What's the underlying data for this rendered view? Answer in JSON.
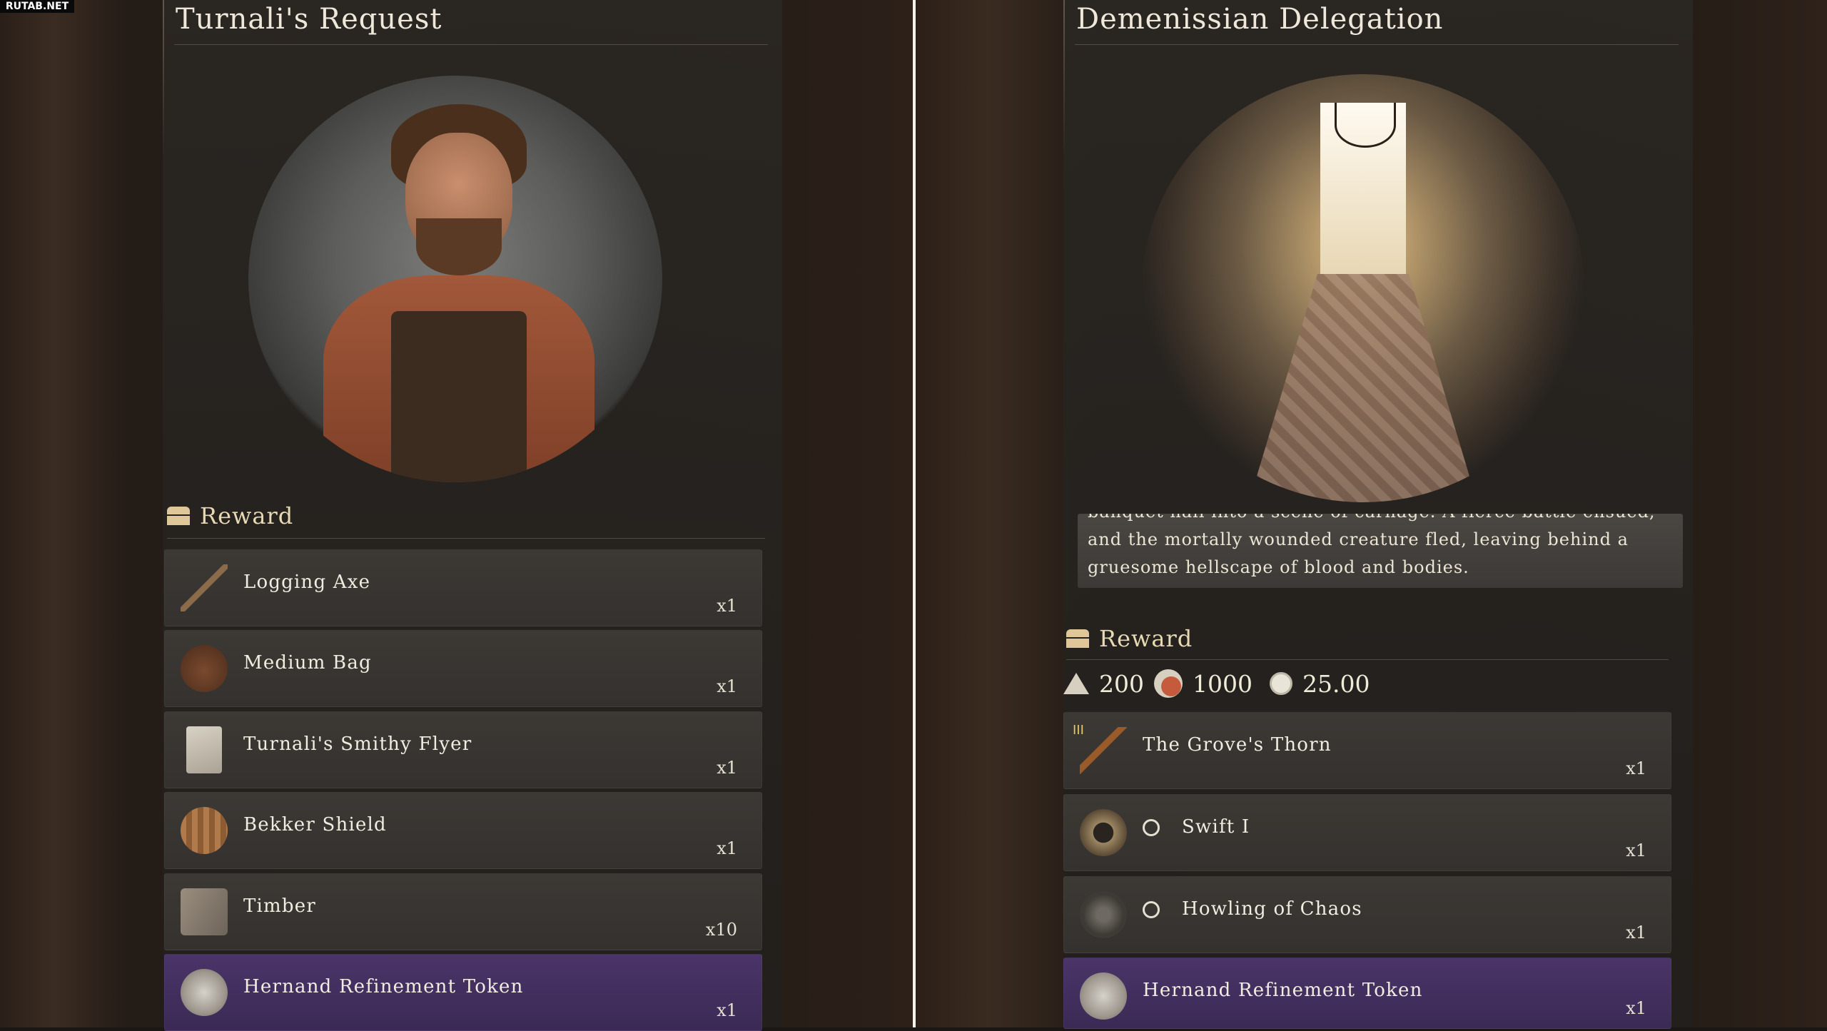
{
  "watermark": "RUTAB.NET",
  "left_panel": {
    "title": "Turnali's Request",
    "reward_label": "Reward",
    "items": [
      {
        "name": "Logging Axe",
        "qty": "x1",
        "icon": "axe-icon"
      },
      {
        "name": "Medium Bag",
        "qty": "x1",
        "icon": "bag-icon"
      },
      {
        "name": "Turnali's Smithy Flyer",
        "qty": "x1",
        "icon": "flyer-icon"
      },
      {
        "name": "Bekker Shield",
        "qty": "x1",
        "icon": "shield-icon"
      },
      {
        "name": "Timber",
        "qty": "x10",
        "icon": "timber-icon"
      },
      {
        "name": "Hernand Refinement Token",
        "qty": "x1",
        "icon": "token-icon"
      }
    ]
  },
  "right_panel": {
    "title": "Demenissian Delegation",
    "description": {
      "cut_line": "banquet hall into a scene of carnage. A fierce battle ensued,",
      "line1": "and the mortally wounded creature fled, leaving behind a",
      "line2": "gruesome hellscape of blood and bodies."
    },
    "reward_label": "Reward",
    "currency": {
      "reputation": "200",
      "contribution": "1000",
      "silver": "25.00"
    },
    "items": [
      {
        "name": "The Grove's Thorn",
        "qty": "x1",
        "icon": "weapon-icon",
        "rarity": "III"
      },
      {
        "name": "Swift I",
        "qty": "x1",
        "icon": "swift-icon"
      },
      {
        "name": "Howling of Chaos",
        "qty": "x1",
        "icon": "chaos-icon"
      },
      {
        "name": "Hernand Refinement Token",
        "qty": "x1",
        "icon": "token-icon"
      }
    ]
  },
  "colors": {
    "accent_gold": "#e0c79a",
    "purple_highlight": "#4a3468",
    "item_bg": "#3c3935"
  }
}
